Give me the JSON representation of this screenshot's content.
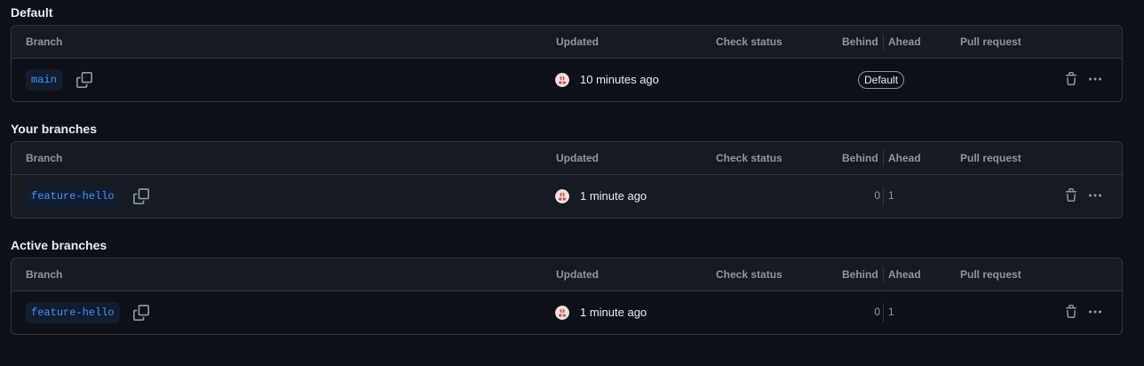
{
  "columns": {
    "branch": "Branch",
    "updated": "Updated",
    "check_status": "Check status",
    "behind": "Behind",
    "ahead": "Ahead",
    "pull_request": "Pull request"
  },
  "sections": [
    {
      "title": "Default",
      "row": {
        "branch": "main",
        "updated": "10 minutes ago",
        "badge": "Default",
        "behind": "",
        "ahead": ""
      }
    },
    {
      "title": "Your branches",
      "row": {
        "branch": "feature-hello",
        "updated": "1 minute ago",
        "badge": "",
        "behind": "0",
        "ahead": "1"
      }
    },
    {
      "title": "Active branches",
      "row": {
        "branch": "feature-hello",
        "updated": "1 minute ago",
        "badge": "",
        "behind": "0",
        "ahead": "1"
      }
    }
  ],
  "icons": {
    "copy": "copy-icon",
    "trash": "trash-icon",
    "more": "kebab-horizontal-icon",
    "avatar": "user-avatar"
  },
  "colors": {
    "background": "#0d1117",
    "header_bg": "#161b22",
    "border": "#30363d",
    "link": "#4493f8",
    "muted": "#8d96a0"
  }
}
